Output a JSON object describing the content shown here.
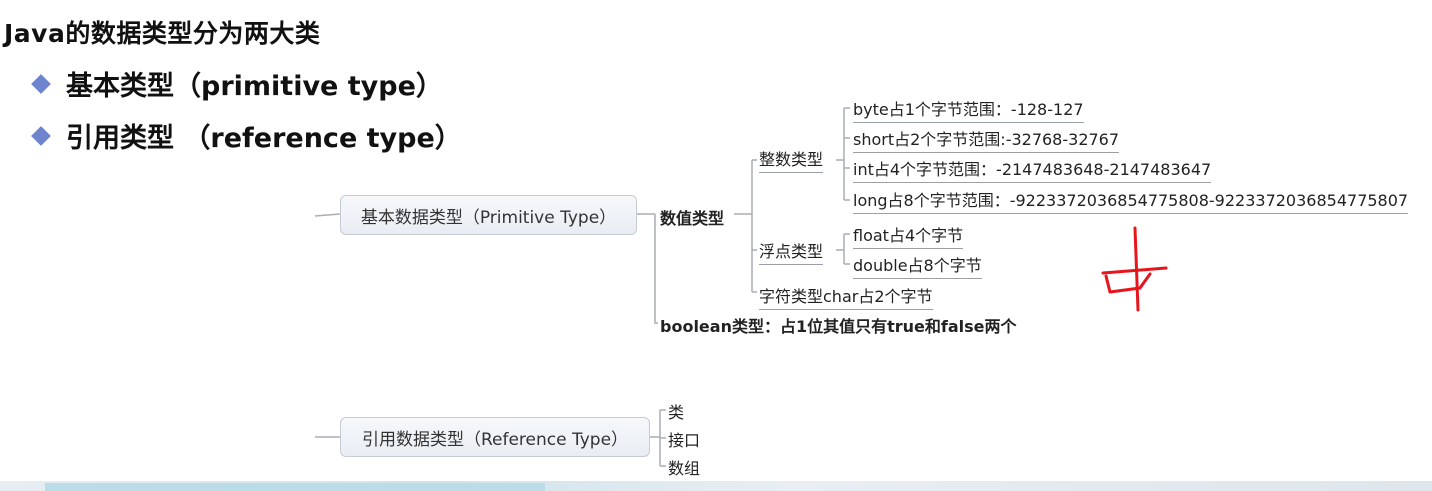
{
  "title": "Java的数据类型分为两大类",
  "bullets": [
    "基本类型（primitive type）",
    "引用类型 （reference type）"
  ],
  "colors": {
    "bullet": "#6f84cf",
    "pen": "#e8141c"
  },
  "mindmap": {
    "primitive_node": "基本数据类型（Primitive Type）",
    "numeric": "数值类型",
    "integer": "整数类型",
    "int_items": [
      "byte占1个字节范围：-128-127",
      "short占2个字节范围:-32768-32767",
      "int占4个字节范围：-2147483648-2147483647",
      "long占8个字节范围：-9223372036854775808-9223372036854775807"
    ],
    "float": "浮点类型",
    "float_items": [
      "float占4个字节",
      "double占8个字节"
    ],
    "char": "字符类型char占2个字节",
    "boolean": "boolean类型：占1位其值只有true和false两个",
    "reference_node": "引用数据类型（Reference Type）",
    "ref_items": [
      "类",
      "接口",
      "数组"
    ]
  }
}
